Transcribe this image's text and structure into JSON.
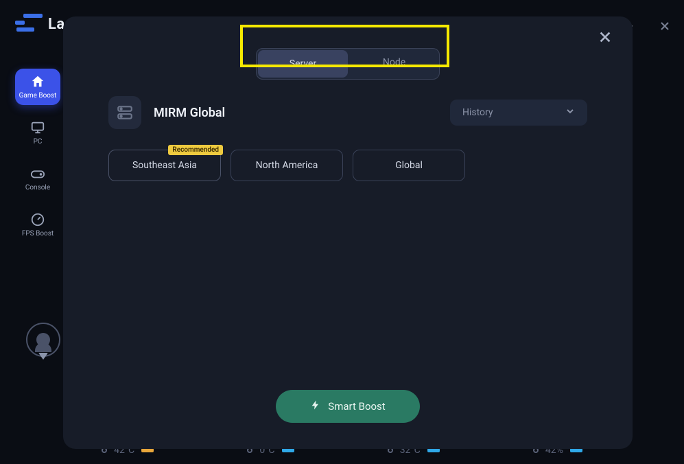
{
  "brand": {
    "name": "LagoFas"
  },
  "sidebar": {
    "items": [
      {
        "label": "Game Boost"
      },
      {
        "label": "PC"
      },
      {
        "label": "Console"
      },
      {
        "label": "FPS Boost"
      }
    ]
  },
  "stats": [
    {
      "value": "42°C"
    },
    {
      "value": "0°C"
    },
    {
      "value": "32°C"
    },
    {
      "value": "42%"
    }
  ],
  "modal": {
    "tabs": {
      "server": "Server",
      "node": "Node"
    },
    "game_title": "MIRM Global",
    "history_label": "History",
    "recommended_label": "Recommended",
    "regions": [
      {
        "name": "Southeast Asia",
        "recommended": true
      },
      {
        "name": "North America",
        "recommended": false
      },
      {
        "name": "Global",
        "recommended": false
      }
    ],
    "smart_boost_label": "Smart Boost"
  }
}
